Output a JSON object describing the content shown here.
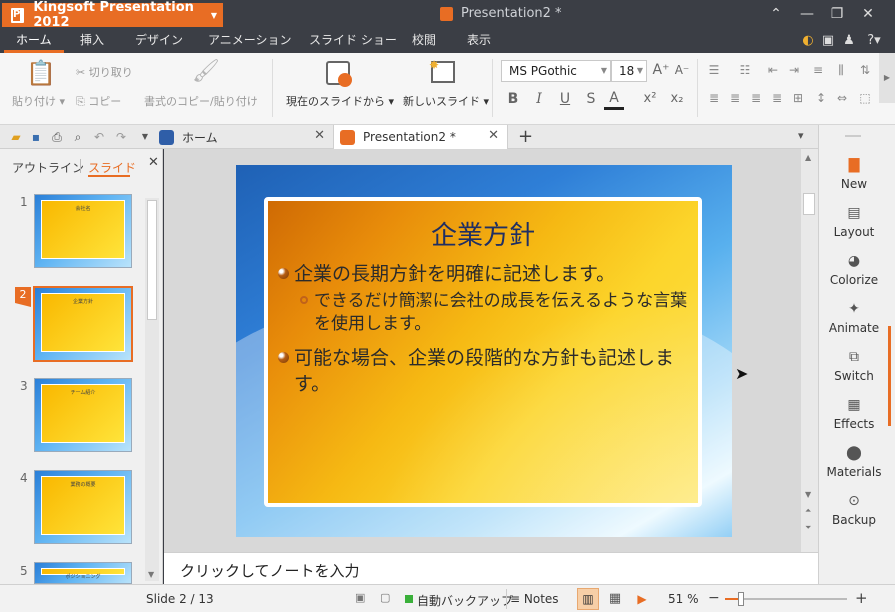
{
  "app": {
    "name": "Kingsoft Presentation 2012",
    "document_title": "Presentation2 *"
  },
  "menu": [
    "ホーム",
    "挿入",
    "デザイン",
    "アニメーション",
    "スライド ショー",
    "校閲",
    "表示"
  ],
  "ribbon": {
    "paste": "貼り付け",
    "cut": "切り取り",
    "copy": "コピー",
    "format_painter": "書式のコピー/貼り付け",
    "from_current": "現在のスライドから",
    "new_slide": "新しいスライド",
    "font_name": "MS PGothic",
    "font_size": "18"
  },
  "tabs": {
    "home": "ホーム",
    "document": "Presentation2 *"
  },
  "panel": {
    "tab_outline": "アウトライン",
    "tab_slides": "スライド",
    "thumbs": [
      {
        "num": "1",
        "title": "会社名"
      },
      {
        "num": "2",
        "title": "企業方針"
      },
      {
        "num": "3",
        "title": "チーム紹介"
      },
      {
        "num": "4",
        "title": "業務の概要"
      },
      {
        "num": "5",
        "title": "ポジショニング"
      }
    ],
    "selected_index": 2
  },
  "slide": {
    "title": "企業方針",
    "bullet1": "企業の長期方針を明確に記述します。",
    "bullet1_sub": "できるだけ簡潔に会社の成長を伝えるような言葉を使用します。",
    "bullet2": "可能な場合、企業の段階的な方針も記述します。"
  },
  "notes_placeholder": "クリックしてノートを入力",
  "task_pane": [
    "New",
    "Layout",
    "Colorize",
    "Animate",
    "Switch",
    "Effects",
    "Materials",
    "Backup"
  ],
  "status": {
    "slide_indicator": "Slide 2 / 13",
    "auto_backup": "自動バックアップ",
    "notes": "Notes",
    "zoom": "51 %",
    "zoom_value": 51
  },
  "colors": {
    "accent": "#e86d24",
    "titlebar": "#3b3e45",
    "slide_title": "#1f2f63"
  }
}
